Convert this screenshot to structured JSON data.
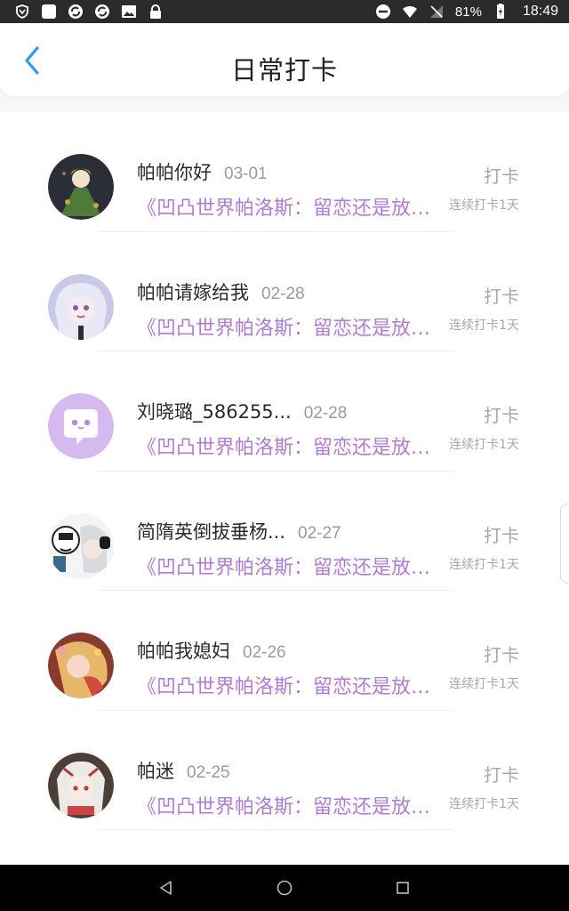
{
  "status_bar": {
    "battery": "81%",
    "time": "18:49",
    "left_icons": [
      "shield-icon",
      "square-icon",
      "sync-icon",
      "sync-icon",
      "image-icon",
      "lock-icon"
    ],
    "right_icons": [
      "dnd-icon",
      "wifi-icon",
      "no-signal-icon",
      "battery-charging-icon"
    ]
  },
  "header": {
    "title": "日常打卡",
    "back_icon": "chevron-left-icon",
    "accent": "#2b9af3"
  },
  "colors": {
    "topic": "#b27ad8",
    "muted": "#a9a9a9",
    "name": "#2a2a2a"
  },
  "checkins": [
    {
      "name": "帕帕你好",
      "date": "03-01",
      "topic": "《凹凸世界帕洛斯：留恋还是放下》",
      "action": "打卡",
      "streak": "连续打卡1天",
      "avatar": "avatar-green-dress"
    },
    {
      "name": "帕帕请嫁给我",
      "date": "02-28",
      "topic": "《凹凸世界帕洛斯：留恋还是放下》",
      "action": "打卡",
      "streak": "连续打卡1天",
      "avatar": "avatar-white-hair"
    },
    {
      "name": "刘晓璐_586255...",
      "date": "02-28",
      "topic": "《凹凸世界帕洛斯：留恋还是放下》",
      "action": "打卡",
      "streak": "连续打卡1天",
      "avatar": "avatar-default-chat"
    },
    {
      "name": "简隋英倒拔垂杨...",
      "date": "02-27",
      "topic": "《凹凸世界帕洛斯：留恋还是放下》",
      "action": "打卡",
      "streak": "连续打卡1天",
      "avatar": "avatar-meme"
    },
    {
      "name": "帕帕我媳妇",
      "date": "02-26",
      "topic": "《凹凸世界帕洛斯：留恋还是放下》",
      "action": "打卡",
      "streak": "连续打卡1天",
      "avatar": "avatar-warm-anime"
    },
    {
      "name": "帕迷",
      "date": "02-25",
      "topic": "《凹凸世界帕洛斯：留恋还是放下》",
      "action": "打卡",
      "streak": "连续打卡1天",
      "avatar": "avatar-silver-hair"
    }
  ],
  "nav_bar": {
    "icons": [
      "back-triangle-icon",
      "home-circle-icon",
      "recents-square-icon"
    ]
  }
}
